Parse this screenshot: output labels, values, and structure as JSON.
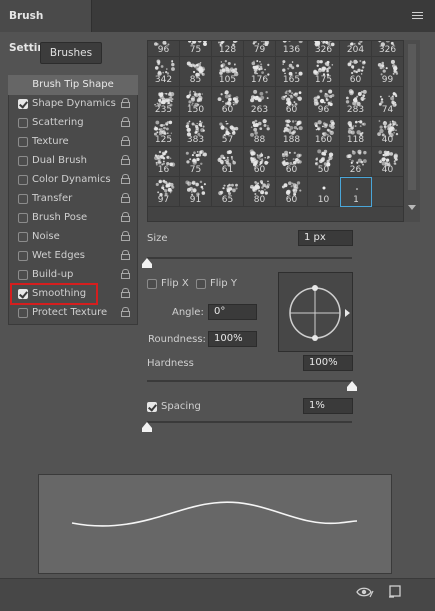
{
  "panel": {
    "tab_title": "Brush Settings"
  },
  "buttons": {
    "brushes": "Brushes"
  },
  "left_list": {
    "header": "Brush Tip Shape",
    "items": [
      {
        "label": "Shape Dynamics",
        "checked": true
      },
      {
        "label": "Scattering",
        "checked": false
      },
      {
        "label": "Texture",
        "checked": false
      },
      {
        "label": "Dual Brush",
        "checked": false
      },
      {
        "label": "Color Dynamics",
        "checked": false
      },
      {
        "label": "Transfer",
        "checked": false
      },
      {
        "label": "Brush Pose",
        "checked": false
      },
      {
        "label": "Noise",
        "checked": false
      },
      {
        "label": "Wet Edges",
        "checked": false
      },
      {
        "label": "Build-up",
        "checked": false
      },
      {
        "label": "Smoothing",
        "checked": true
      },
      {
        "label": "Protect Texture",
        "checked": false
      }
    ]
  },
  "brush_grid": {
    "rows": [
      [
        "96",
        "75",
        "128",
        "79",
        "136",
        "326",
        "204",
        "326"
      ],
      [
        "342",
        "85",
        "105",
        "176",
        "165",
        "175",
        "60",
        "99"
      ],
      [
        "235",
        "150",
        "60",
        "263",
        "60",
        "96",
        "283",
        "74"
      ],
      [
        "125",
        "383",
        "57",
        "88",
        "188",
        "160",
        "118",
        "40"
      ],
      [
        "16",
        "75",
        "61",
        "60",
        "60",
        "50",
        "26",
        "40"
      ],
      [
        "97",
        "91",
        "65",
        "80",
        "60",
        "10",
        "1",
        ""
      ]
    ],
    "selected": "1"
  },
  "tip": {
    "size_label": "Size",
    "size_value": "1 px",
    "size_level": 0.0,
    "flip_x": "Flip X",
    "flip_y": "Flip Y",
    "angle_label": "Angle:",
    "angle_value": "0°",
    "roundness_label": "Roundness:",
    "roundness_value": "100%",
    "hardness_label": "Hardness",
    "hardness_value": "100%",
    "hardness_level": 1.0,
    "spacing_label": "Spacing",
    "spacing_value": "1%",
    "spacing_checked": true,
    "spacing_level": 0.0
  },
  "icons": {
    "menu": "menu-icon",
    "lock": "lock-icon",
    "create_new": "new-brush-icon",
    "toggle_preview": "eye-icon"
  }
}
